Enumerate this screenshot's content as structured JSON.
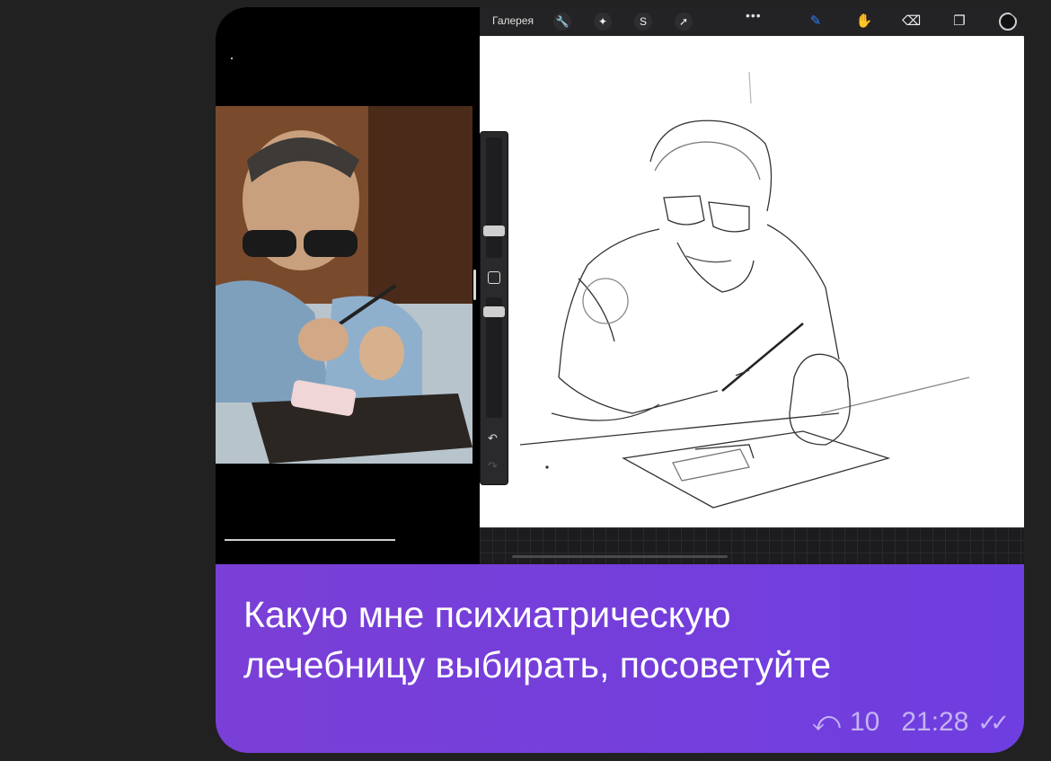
{
  "message": {
    "text_line1": "Какую мне психиатрическую",
    "text_line2": "лечебницу выбирать, посоветуйте",
    "replies_count": "10",
    "time": "21:28",
    "reply_glyph": "⤺",
    "read_glyph": "✓✓"
  },
  "procreate": {
    "gallery_label": "Галерея",
    "more_glyph": "•••",
    "tool_icons": [
      {
        "name": "wrench-icon",
        "glyph": "🔧"
      },
      {
        "name": "magic-wand-icon",
        "glyph": "✦"
      },
      {
        "name": "selection-icon",
        "glyph": "S"
      },
      {
        "name": "transform-icon",
        "glyph": "➚"
      }
    ],
    "right_tools": [
      {
        "name": "brush-icon",
        "glyph": "✎"
      },
      {
        "name": "smudge-icon",
        "glyph": "✋"
      },
      {
        "name": "eraser-icon",
        "glyph": "⌫"
      },
      {
        "name": "layers-icon",
        "glyph": "❐"
      }
    ],
    "undo_glyph": "↶",
    "redo_glyph": "↷"
  },
  "colors": {
    "bubble_start": "#7a3fd6",
    "bubble_end": "#6f3ee0",
    "background": "#212121",
    "meta_text": "#c5b3f3",
    "brush_active": "#2f7ff5"
  }
}
